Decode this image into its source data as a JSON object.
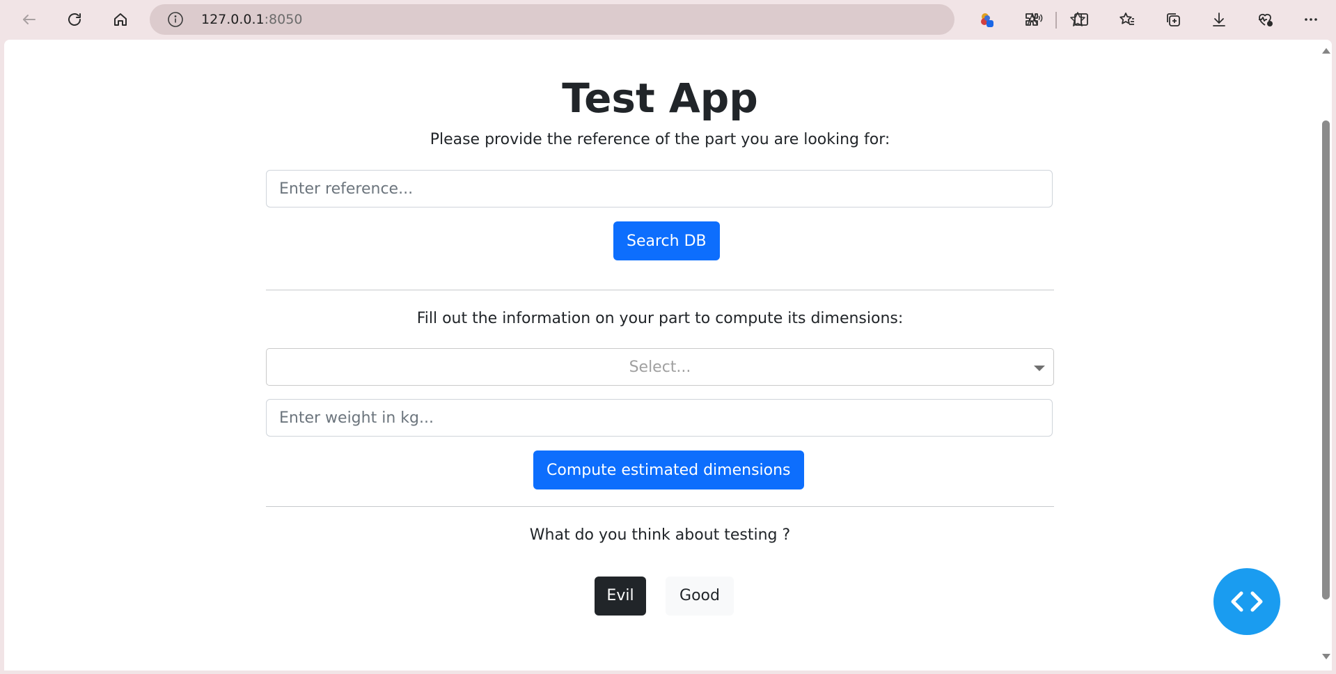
{
  "browser": {
    "url_host": "127.0.0.1",
    "url_port": ":8050",
    "icons": [
      "back-icon",
      "refresh-icon",
      "home-icon",
      "info-icon",
      "read-aloud-icon",
      "favorite-star-icon",
      "profile-icon",
      "extensions-icon",
      "split-screen-icon",
      "favorites-icon",
      "collections-icon",
      "downloads-icon",
      "browser-essentials-icon",
      "more-icon"
    ]
  },
  "app": {
    "title": "Test App",
    "search_prompt": "Please provide the reference of the part you are looking for:",
    "reference_placeholder": "Enter reference...",
    "search_button": "Search DB",
    "dimensions_prompt": "Fill out the information on your part to compute its dimensions:",
    "select_placeholder": "Select...",
    "weight_placeholder": "Enter weight in kg...",
    "compute_button": "Compute estimated dimensions",
    "testing_question": "What do you think about testing ?",
    "options": [
      {
        "label": "Evil",
        "selected": true
      },
      {
        "label": "Good",
        "selected": false
      }
    ]
  },
  "colors": {
    "primary": "#0d6efd",
    "dark": "#212529",
    "fab": "#1a9cf0"
  }
}
